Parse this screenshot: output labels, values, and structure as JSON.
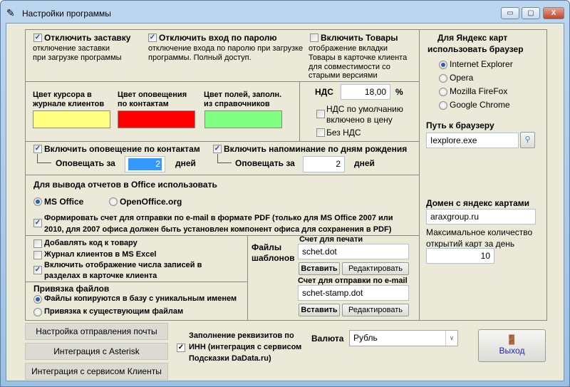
{
  "window": {
    "title": "Настройки программы",
    "minimize": "▭",
    "maximize": "▢",
    "close": "X"
  },
  "general": {
    "disable_splash": {
      "label": "Отключить заставку",
      "desc1": "отключение заставки",
      "desc2": "при загрузке программы",
      "checked": true
    },
    "disable_password": {
      "label": "Отключить вход по паролю",
      "desc1": "отключение входа по паролю при загрузке",
      "desc2": "программы. Полный доступ.",
      "checked": true
    },
    "enable_goods": {
      "label": "Включить Товары",
      "desc": [
        "отображение вкладки",
        "Товары в карточке клиента",
        "для совместимости со",
        "старыми версиями"
      ],
      "checked": false
    }
  },
  "colors": {
    "cursor": {
      "l1": "Цвет курсора в",
      "l2": "журнале клиентов",
      "color": "#ffff80"
    },
    "notify": {
      "l1": "Цвет оповещения",
      "l2": "по контактам",
      "color": "#ff0000"
    },
    "fields": {
      "l1": "Цвет полей, заполн.",
      "l2": "из справочников",
      "color": "#80ff80"
    }
  },
  "vat": {
    "label": "НДС",
    "value": "18,00",
    "unit": "%",
    "included_l1": "НДС по умолчанию",
    "included_l2": "включено в цену",
    "included": false,
    "no_vat": "Без НДС",
    "no_vat_checked": false
  },
  "notifications": {
    "contacts": {
      "label": "Включить оповещение по контактам",
      "checked": true,
      "notify_label": "Оповещать за",
      "days": "2",
      "days_label": "дней"
    },
    "birthdays": {
      "label": "Включить напоминание по дням рождения",
      "checked": true,
      "notify_label": "Оповещать за",
      "days": "2",
      "days_label": "дней"
    }
  },
  "office": {
    "title": "Для вывода отчетов в Office использовать",
    "ms": "MS Office",
    "oo": "OpenOffice.org",
    "selected": "MS Office",
    "pdf_l1": "Формировать счет для отправки по e-mail в формате PDF (только для MS Office 2007 или",
    "pdf_l2": "2010, для 2007 офиса должен быть установлен компонент офиса для  сохранения в PDF)",
    "pdf_checked": true
  },
  "misc": {
    "add_code": {
      "label": "Добавлять код к товару",
      "checked": false
    },
    "excel": {
      "label": "Журнал клиентов в MS Excel",
      "checked": false
    },
    "counts": {
      "l1": "Включить отображение числа записей в",
      "l2": "разделах в карточке клиента",
      "checked": true
    }
  },
  "files": {
    "title": "Привязка файлов",
    "copy": "Файлы копируются в базу с уникальным именем",
    "link": "Привязка к существующим файлам",
    "selected": "copy"
  },
  "templates": {
    "title1": "Файлы",
    "title2": "шаблонов",
    "print_label": "Счет для печати",
    "print_value": "schet.dot",
    "email_label": "Счет для отправки по e-mail",
    "email_value": "schet-stamp.dot",
    "insert": "Вставить",
    "edit": "Редактировать"
  },
  "browser": {
    "title1": "Для Яндекс карт",
    "title2": "использовать браузер",
    "options": [
      "Internet Explorer",
      "Opera",
      "Mozilla FireFox",
      "Google Chrome"
    ],
    "selected": 0,
    "path_label": "Путь к браузеру",
    "path": "Iexplore.exe"
  },
  "maps": {
    "domain_label": "Домен с яндекс картами",
    "domain": "araxgroup.ru",
    "max_l1": "Максимальное количество",
    "max_l2": "открытий карт за день",
    "max": "10"
  },
  "bottom": {
    "mail_btn": "Настройка отправления почты",
    "asterisk_btn": "Интеграция с Asterisk",
    "clients_btn": "Интеграция с сервисом Клиенты",
    "inn_l1": "Заполнение реквизитов по",
    "inn_l2": "ИНН (интеграция с сервисом",
    "inn_l3": "Подсказки DaData.ru)",
    "inn_checked": true,
    "currency_label": "Валюта",
    "currency": "Рубль",
    "exit": "Выход"
  }
}
